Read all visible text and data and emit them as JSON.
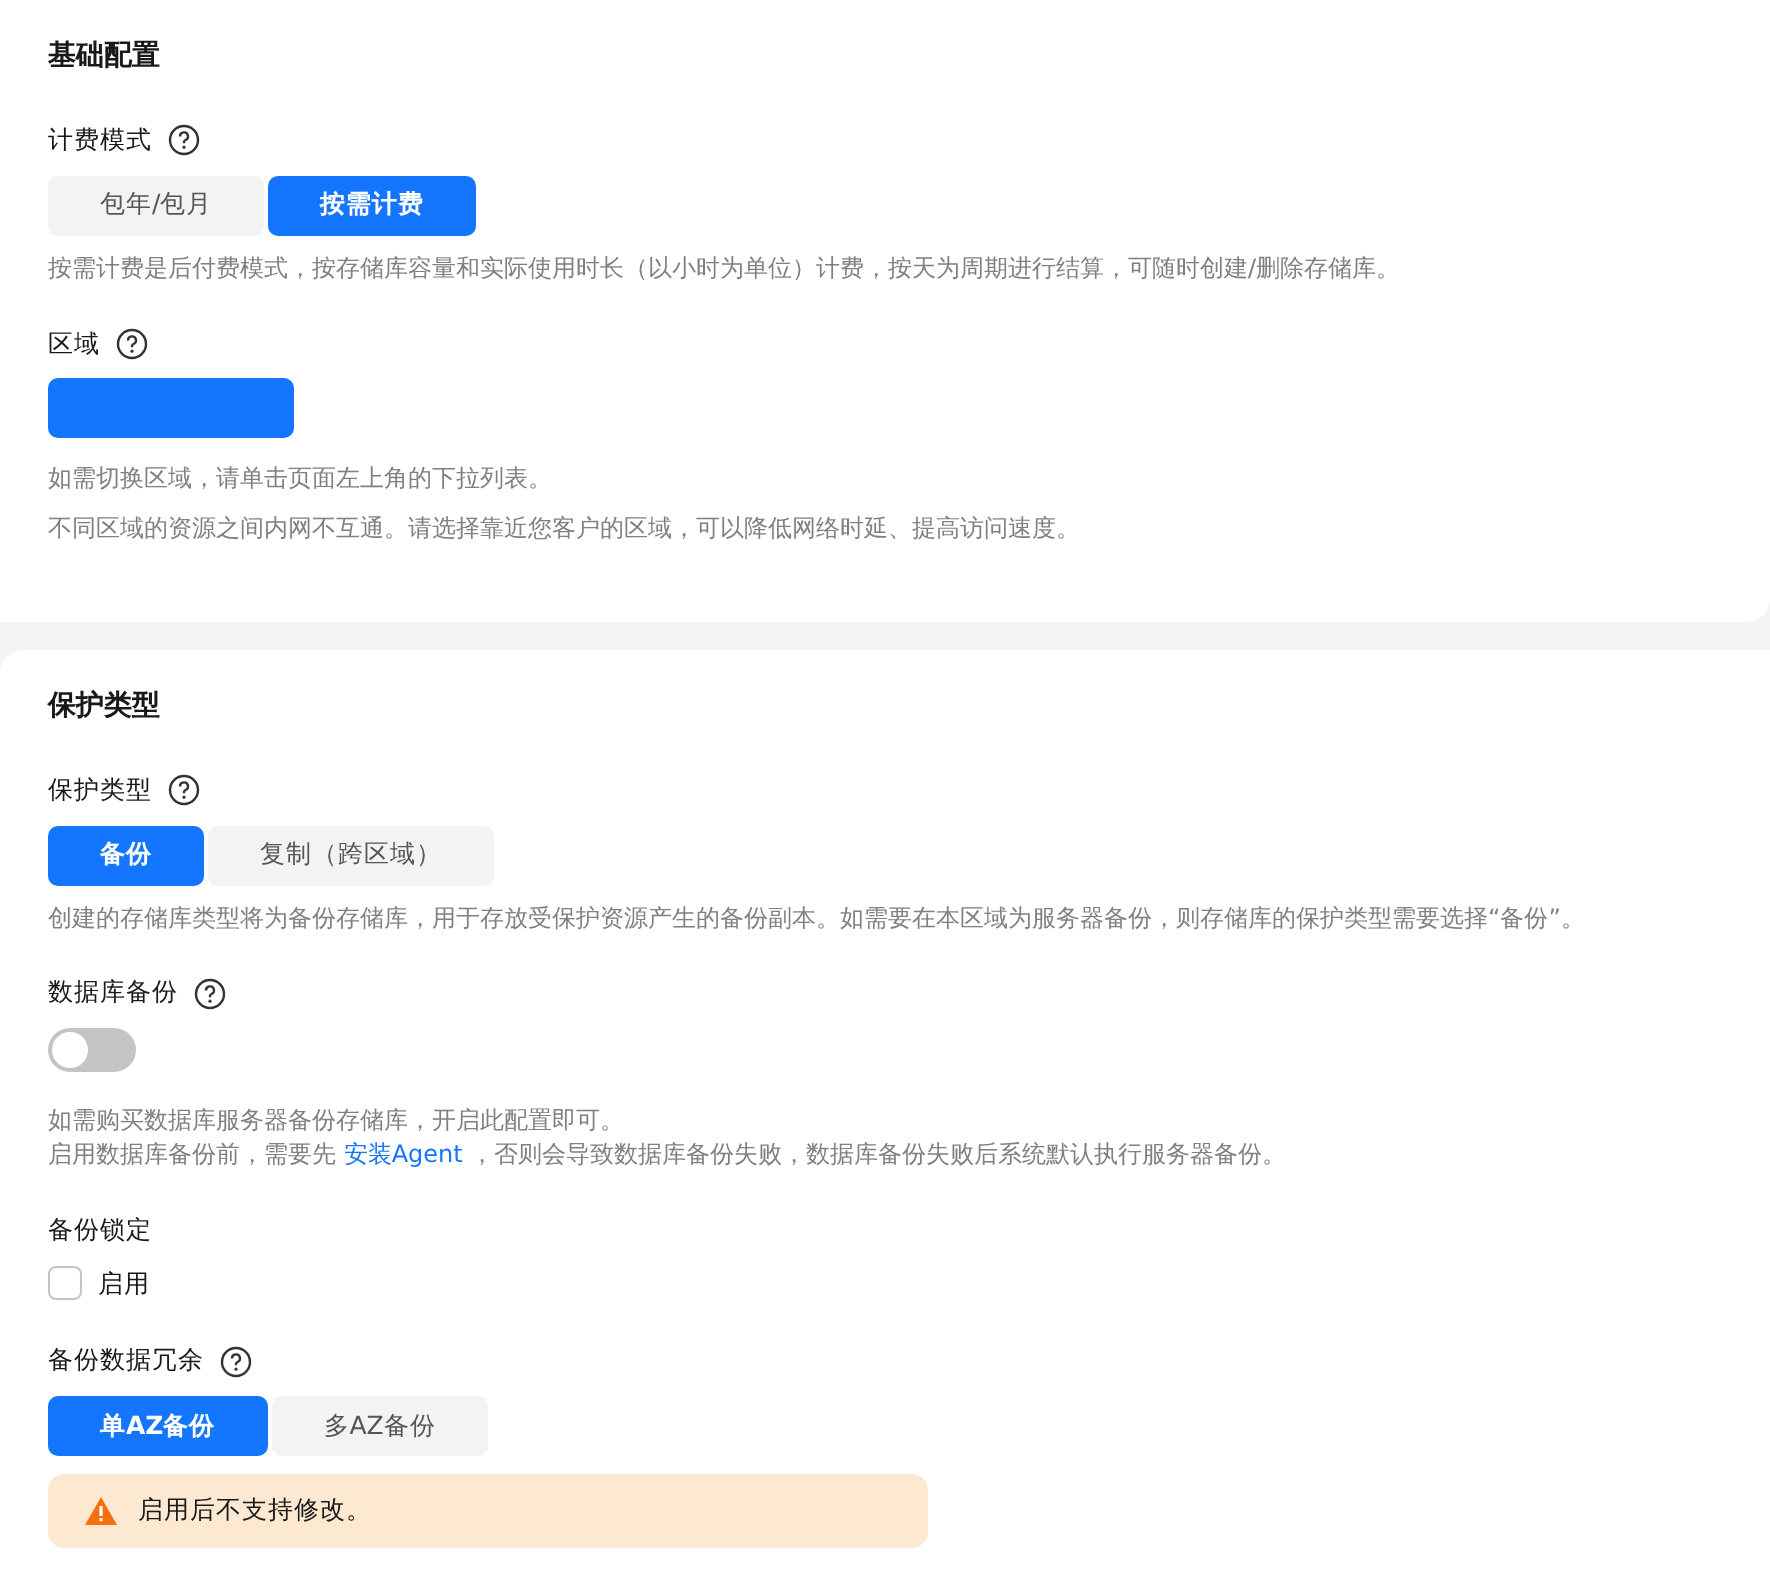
{
  "sections": [
    {
      "title": "基础配置",
      "fields": [
        {
          "label": "计费模式",
          "help_icon": true,
          "kind": "segmented",
          "options": [
            {
              "label": "包年/包月",
              "selected": false
            },
            {
              "label": "按需计费",
              "selected": true
            }
          ],
          "notes": [
            {
              "text": "按需计费是后付费模式，按存储库容量和实际使用时长（以小时为单位）计费，按天为周期进行结算，可随时创建/删除存储库。"
            }
          ]
        },
        {
          "label": "区域",
          "help_icon": true,
          "kind": "region",
          "selected": true,
          "notes": [
            {
              "text": "如需切换区域，请单击页面左上角的下拉列表。"
            },
            {
              "text": "不同区域的资源之间内网不互通。请选择靠近您客户的区域，可以降低网络时延、提高访问速度。"
            }
          ]
        }
      ]
    },
    {
      "title": "保护类型",
      "fields": [
        {
          "label": "保护类型",
          "help_icon": true,
          "kind": "segmented",
          "options": [
            {
              "label": "备份",
              "selected": true
            },
            {
              "label": "复制（跨区域）",
              "selected": false
            }
          ],
          "notes": [
            {
              "text": "创建的存储库类型将为备份存储库，用于存放受保护资源产生的备份副本。如需要在本区域为服务器备份，则存储库的保护类型需要选择“备份”。"
            }
          ]
        },
        {
          "label": "数据库备份",
          "help_icon": true,
          "kind": "toggle",
          "on": false,
          "notes": [
            {
              "text": "如需购买数据库服务器备份存储库，开启此配置即可。"
            },
            {
              "text": "启用数据库备份前，需要先",
              "link": "安装Agent",
              "after": "，否则会导致数据库备份失败，数据库备份失败后系统默认执行服务器备份。"
            }
          ]
        },
        {
          "label": "备份锁定",
          "help_icon": false,
          "kind": "checkbox",
          "checkbox_label": "启用",
          "checked": false
        },
        {
          "label": "备份数据冗余",
          "help_icon": true,
          "kind": "segmented",
          "options": [
            {
              "label": "单AZ备份",
              "selected": true
            },
            {
              "label": "多AZ备份",
              "selected": false
            }
          ],
          "alert": {
            "text": "启用后不支持修改。"
          }
        }
      ]
    }
  ]
}
